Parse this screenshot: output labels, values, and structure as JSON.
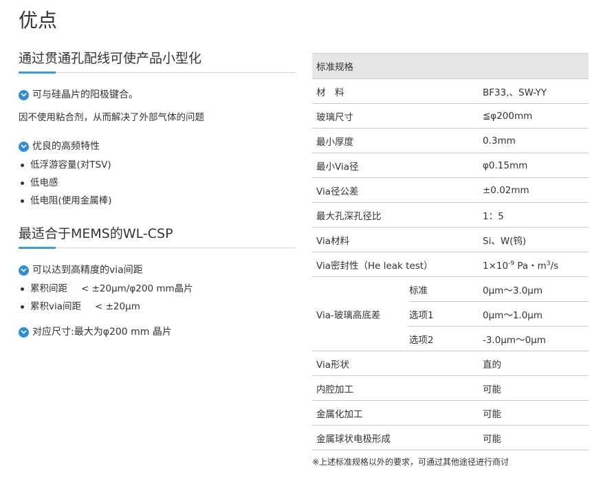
{
  "page_title": "优点",
  "section1": {
    "heading": "通过贯通孔配线可使产品小型化",
    "point1": "可与硅晶片的阳极键合。",
    "text1": "因不使用粘合剂，从而解决了外部气体的问题",
    "point2": "优良的高频特性",
    "bullets": [
      "低浮游容量(对TSV)",
      "低电感",
      "低电阻(使用金属棒)"
    ]
  },
  "section2": {
    "heading": "最适合于MEMS的WL-CSP",
    "point1": "可以达到高精度的via间距",
    "bullets": [
      {
        "label": "累积间距",
        "value": "< ±20μm/φ200 mm晶片"
      },
      {
        "label": "累积via间距",
        "value": "< ±20μm"
      }
    ],
    "point2": "对应尺寸:最大为φ200 mm 晶片"
  },
  "spec": {
    "header": "标准规格",
    "rows": [
      {
        "label": "材　料",
        "value": "BF33,、SW-YY"
      },
      {
        "label": "玻璃尺寸",
        "value": "≦φ200mm"
      },
      {
        "label": "最小厚度",
        "value": "0.3mm"
      },
      {
        "label": "最小Via径",
        "value": "φ0.15mm"
      },
      {
        "label": "Via径公差",
        "value": "±0.02mm"
      },
      {
        "label": "最大孔深孔径比",
        "value": "1：5"
      },
      {
        "label": "Via材料",
        "value": "Si、W(钨)"
      }
    ],
    "seal": {
      "label": "Via密封性（He leak test）",
      "value_prefix": "1×10",
      "value_exp": "-9",
      "value_mid": " Pa・m",
      "value_exp2": "3",
      "value_suffix": "/s"
    },
    "height_diff": {
      "label": "Via-玻璃高底差",
      "options": [
        {
          "name": "标准",
          "value": "0μm～3.0μm"
        },
        {
          "name": "选项1",
          "value": "0μm～1.0μm"
        },
        {
          "name": "选项2",
          "value": "-3.0μm～0μm"
        }
      ]
    },
    "rows2": [
      {
        "label": "Via形状",
        "value": "直的"
      },
      {
        "label": "内腔加工",
        "value": "可能"
      },
      {
        "label": "金属化加工",
        "value": "可能"
      },
      {
        "label": "金属球状电极形成",
        "value": "可能"
      }
    ],
    "note": "※上述标准规格以外的要求，可通过其他途径进行商讨"
  },
  "colors": {
    "accent": "#2e8fd8",
    "header_bg": "#e6e6e6"
  }
}
